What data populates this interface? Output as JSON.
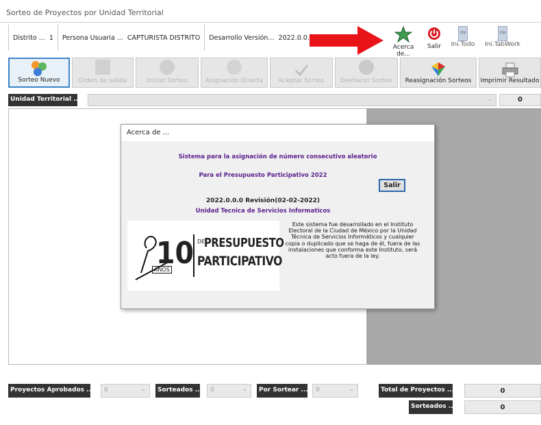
{
  "window": {
    "title": "Sorteo de Proyectos por Unidad Territorial"
  },
  "infobar": {
    "distrito_label": "Distrito ...",
    "distrito_value": "1",
    "persona_label": "Persona Usuaria ...",
    "persona_value": "CAPTURISTA DISTRITO",
    "version_label": "Desarrollo Versión...",
    "version_value": "2022.0.0.0"
  },
  "topicons": [
    {
      "label": "Acerca de...",
      "icon": "star-icon"
    },
    {
      "label": "Salir",
      "icon": "power-icon"
    },
    {
      "label": "Ini.Todo",
      "icon": "zip-icon"
    },
    {
      "label": "Ini.TabWork",
      "icon": "zip-icon"
    }
  ],
  "toolbar": {
    "sorteo_nuevo": "Sorteo Nuevo",
    "orden_salida": "Orden de salida",
    "iniciar_sorteo": "Iniciar Sorteo",
    "asignacion_directa": "Asignación Directa",
    "aceptar_sorteo": "Aceptar Sorteo",
    "deshacer_sorteo": "Deshacer Sorteo",
    "reasignacion": "Reasignación Sorteos",
    "imprimir": "Imprimir Resultado"
  },
  "unidad": {
    "label": "Unidad Territorial ...",
    "count": "0"
  },
  "dialog": {
    "title": "Acerca de ...",
    "line1": "Sistema para la asignación de número consecutivo aleatorio",
    "line2": "Para el  Presupuesto Participativo 2022",
    "salir": "Salir",
    "version": "2022.0.0.0 Revisión(02-02-2022)",
    "unit": "Unidad Tecnica de Servicios Informaticos",
    "description": "Este sistema fue desarrollado en el Instituto Electoral de la Ciudad de México por la Unidad Técnica de Servicios Informáticos y cualquier copia o duplicado que se haga de él, fuera de las instalaciones que conforma este Instituto, será acto fuera de la ley.",
    "logo": {
      "number": "10",
      "years": "AÑOS",
      "de": "DE",
      "word1": "PRESUPUESTO",
      "word2": "PARTICIPATIVO"
    }
  },
  "bottom": {
    "aprobados_label": "Proyectos Aprobados ...",
    "aprobados_value": "0",
    "sorteados_label": "Sorteados ...",
    "sorteados_value": "0",
    "por_sortear_label": "Por Sortear ...",
    "por_sortear_value": "0",
    "total_label": "Total de Proyectos ...",
    "total_value": "0",
    "sorteados2_label": "Sorteados ...",
    "sorteados2_value": "0"
  },
  "colors": {
    "arrow": "#e8141a",
    "accent": "#3a85c9",
    "dialog_text": "#5a1f8c",
    "dark_label": "#333333"
  }
}
